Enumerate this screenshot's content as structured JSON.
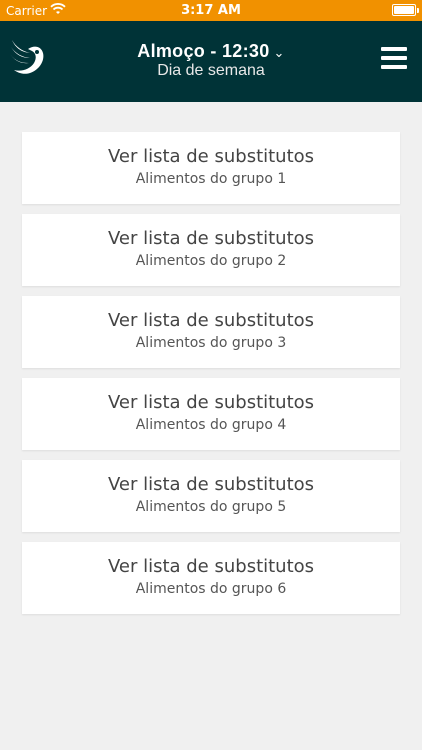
{
  "status_bar": {
    "carrier": "Carrier",
    "time": "3:17 AM"
  },
  "header": {
    "title": "Almoço - 12:30",
    "subtitle": "Dia de semana",
    "logo_icon": "bird-logo-icon",
    "menu_icon": "hamburger-menu-icon",
    "background_color": "#003337"
  },
  "status_bar_color": "#f19100",
  "cards": [
    {
      "title": "Ver lista de substitutos",
      "subtitle": "Alimentos do grupo 1"
    },
    {
      "title": "Ver lista de substitutos",
      "subtitle": "Alimentos do grupo 2"
    },
    {
      "title": "Ver lista de substitutos",
      "subtitle": "Alimentos do grupo 3"
    },
    {
      "title": "Ver lista de substitutos",
      "subtitle": "Alimentos do grupo 4"
    },
    {
      "title": "Ver lista de substitutos",
      "subtitle": "Alimentos do grupo 5"
    },
    {
      "title": "Ver lista de substitutos",
      "subtitle": "Alimentos do grupo 6"
    }
  ]
}
